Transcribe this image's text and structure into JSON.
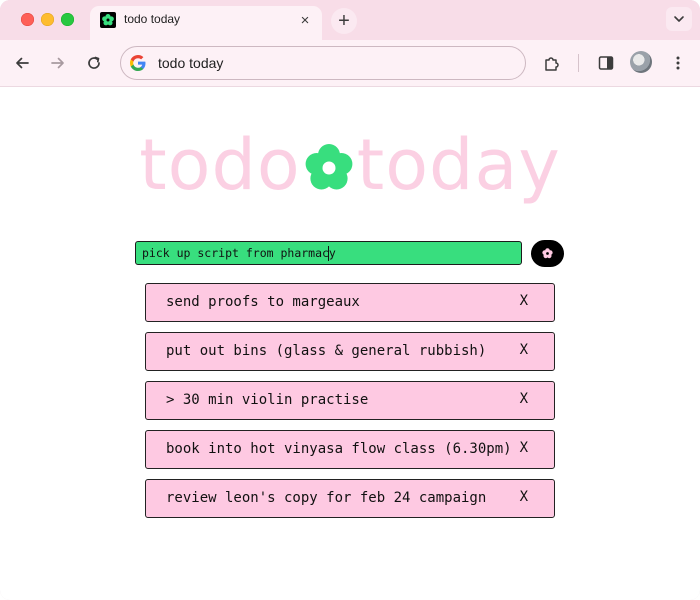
{
  "browser": {
    "tab_title": "todo today",
    "tab_close_label": "×",
    "new_tab_label": "+",
    "address": "todo today"
  },
  "app": {
    "logo_left": "todo",
    "logo_right": "today",
    "input_value": "pick up script from pharmacy",
    "add_button_icon": "flower-icon",
    "colors": {
      "logo_pink": "#fbd0e3",
      "flower_green": "#38de7e",
      "input_green": "#38de7e",
      "item_pink": "#fec9e2",
      "add_button_bg": "#000000",
      "tab_strip": "#f8dde8"
    },
    "todos": [
      {
        "text": "send proofs to margeaux",
        "delete_label": "X"
      },
      {
        "text": "put out bins (glass & general rubbish)",
        "delete_label": "X"
      },
      {
        "text": "> 30 min violin practise",
        "delete_label": "X"
      },
      {
        "text": "book into hot vinyasa flow class (6.30pm)",
        "delete_label": "X"
      },
      {
        "text": "review leon's copy for feb 24 campaign",
        "delete_label": "X"
      }
    ]
  }
}
